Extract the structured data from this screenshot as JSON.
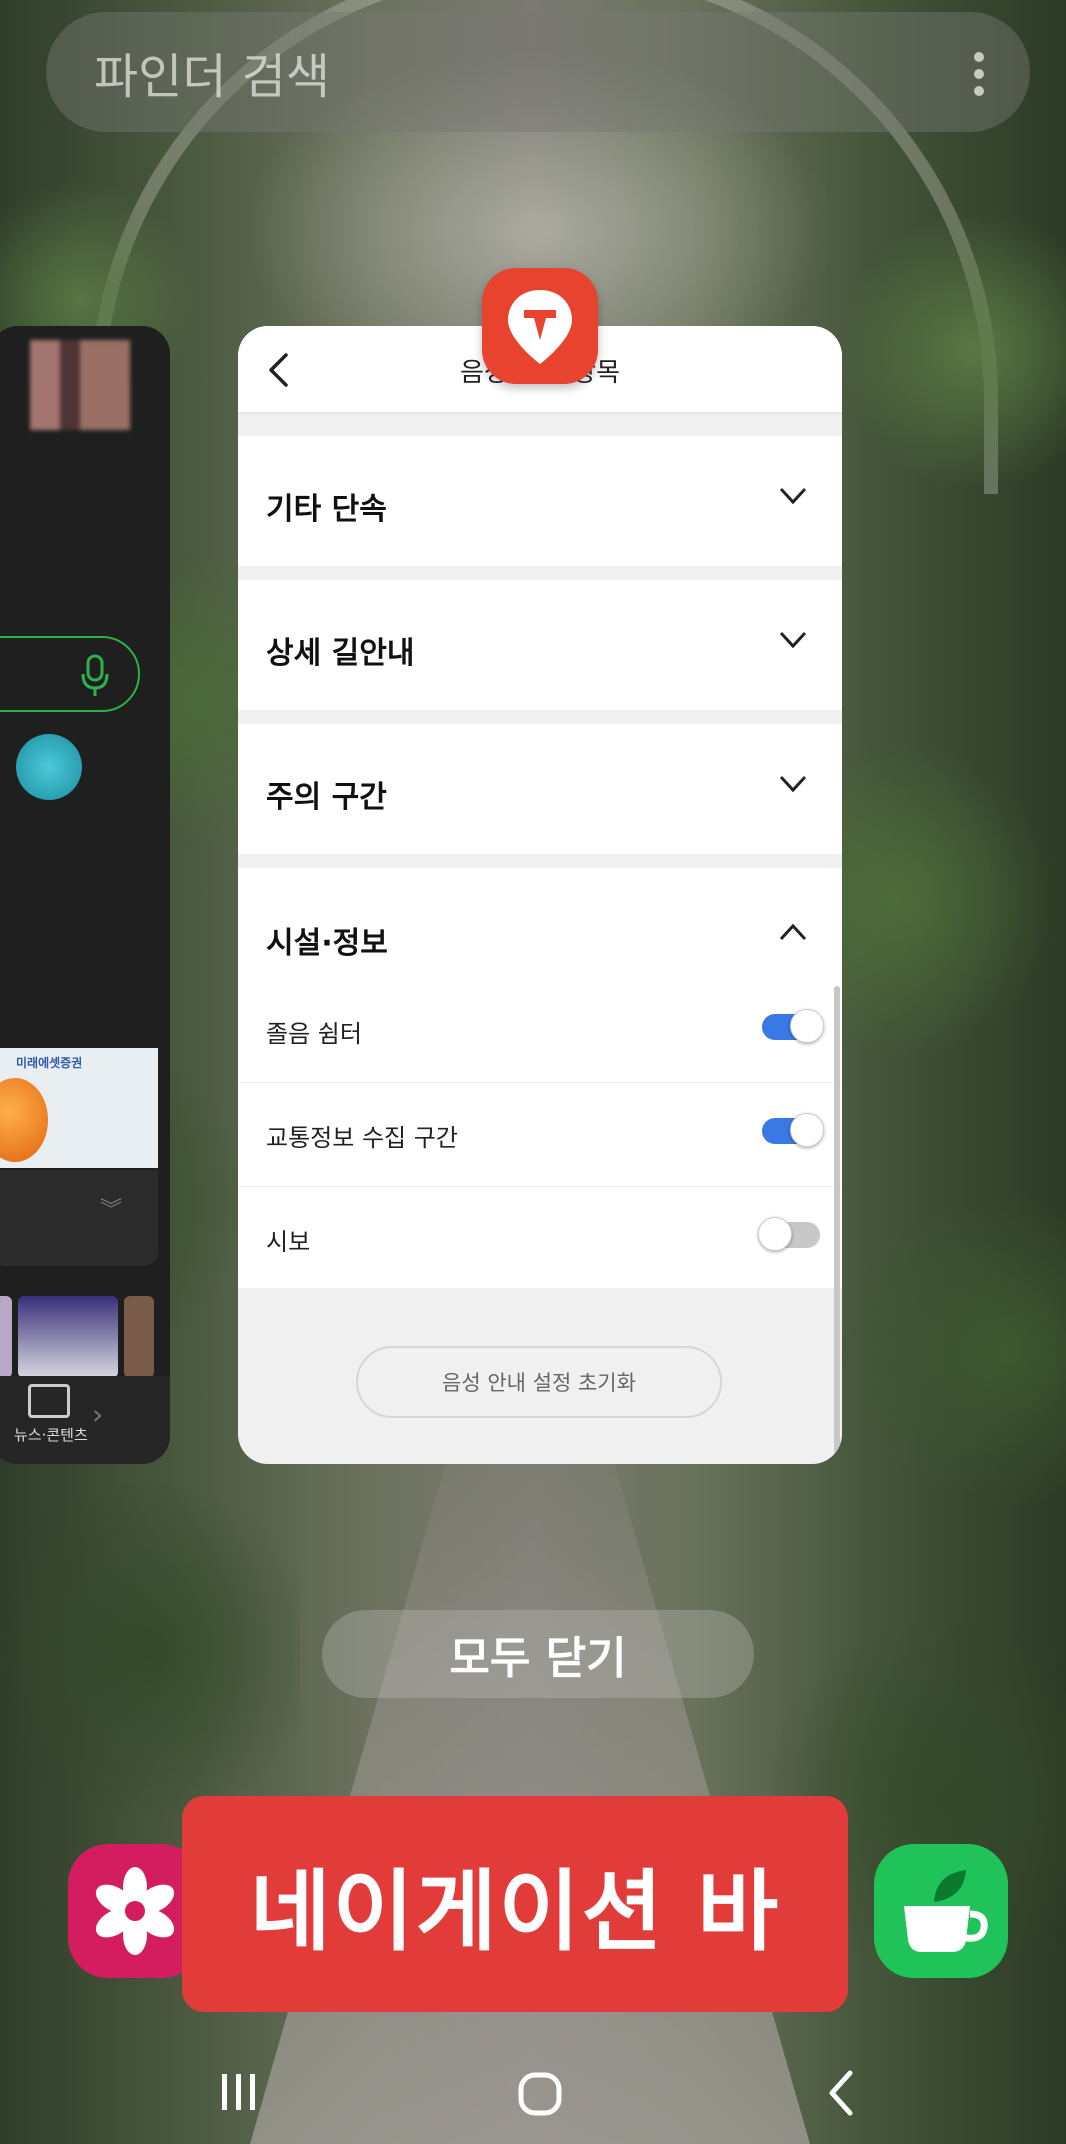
{
  "search": {
    "placeholder": "파인더 검색"
  },
  "left_card": {
    "ad_label": "미래에셋증권",
    "nav_label": "뉴스·콘텐츠"
  },
  "main_card": {
    "title": "음성 안내 항목",
    "sections": [
      {
        "label": "기타 단속",
        "expanded": false
      },
      {
        "label": "상세 길안내",
        "expanded": false
      },
      {
        "label": "주의 구간",
        "expanded": false
      }
    ],
    "expanded_section": {
      "label": "시설·정보",
      "items": [
        {
          "label": "졸음 쉼터",
          "enabled": true
        },
        {
          "label": "교통정보 수집 구간",
          "enabled": true
        },
        {
          "label": "시보",
          "enabled": false
        }
      ]
    },
    "reset_button": "음성 안내 설정 초기화"
  },
  "close_all": "모두 닫기",
  "overlay_label": "네이게이션 바",
  "colors": {
    "accent_toggle": "#3a78e6",
    "banner_red": "#e23c3a",
    "tmap_red": "#e8432f"
  }
}
